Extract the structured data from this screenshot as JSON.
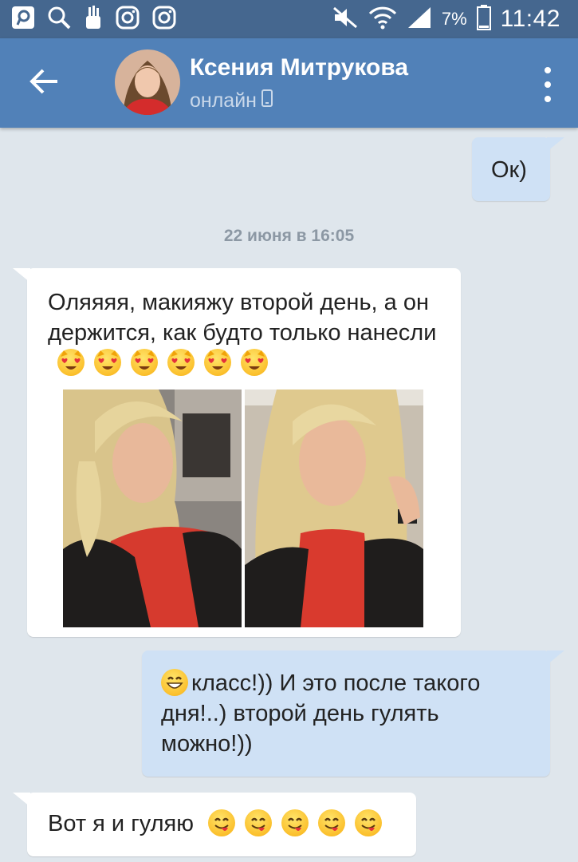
{
  "status_bar": {
    "time": "11:42",
    "battery_percent": "7%",
    "icons": [
      "search-app-icon",
      "search-icon",
      "paint-brush-icon",
      "instagram-icon",
      "instagram-icon",
      "mute-icon",
      "wifi-icon",
      "signal-icon",
      "battery-icon"
    ]
  },
  "header": {
    "contact_name": "Ксения Митрукова",
    "status": "онлайн",
    "icons": [
      "back-arrow-icon",
      "avatar",
      "mobile-phone-icon",
      "more-vert-icon"
    ]
  },
  "messages": [
    {
      "direction": "out",
      "text": "Ок)"
    },
    {
      "type": "date_separator",
      "text": "22 июня в 16:05"
    },
    {
      "direction": "in",
      "text": "Оляяяя, макияжу второй день, а он держится, как будто только нанесли",
      "emoji": [
        "smiling-cat-heart-eyes-icon",
        "smiling-cat-heart-eyes-icon",
        "smiling-cat-heart-eyes-icon",
        "smiling-cat-heart-eyes-icon",
        "smiling-cat-heart-eyes-icon",
        "smiling-cat-heart-eyes-icon"
      ],
      "photos": 2
    },
    {
      "direction": "out",
      "emoji_lead": "grinning-face-icon",
      "text": "класс!)) И это после такого дня!..) второй день гулять можно!))"
    },
    {
      "direction": "in",
      "text": "Вот я и гуляю",
      "emoji": [
        "face-savoring-food-icon",
        "face-savoring-food-icon",
        "face-savoring-food-icon",
        "face-savoring-food-icon",
        "face-savoring-food-icon"
      ]
    }
  ],
  "colors": {
    "status_bar": "#45678f",
    "app_bar": "#5181b8",
    "background": "#dfe6ec",
    "bubble_in": "#ffffff",
    "bubble_out": "#cfe1f5",
    "date_text": "#8c98a4"
  }
}
